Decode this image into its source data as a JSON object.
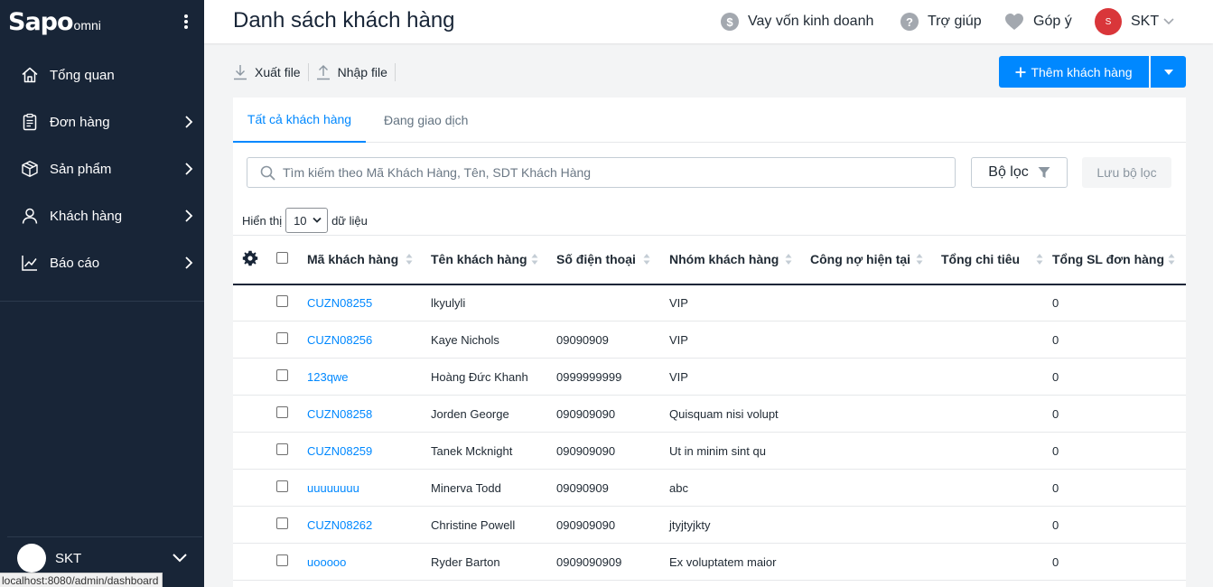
{
  "sidebar": {
    "logo_main": "Sapo",
    "logo_sub": "omni",
    "items": [
      {
        "label": "Tổng quan",
        "icon": "home-icon"
      },
      {
        "label": "Đơn hàng",
        "icon": "clipboard-icon"
      },
      {
        "label": "Sản phẩm",
        "icon": "box-icon"
      },
      {
        "label": "Khách hàng",
        "icon": "person-icon"
      },
      {
        "label": "Báo cáo",
        "icon": "chart-icon"
      }
    ],
    "user_name": "SKT"
  },
  "status_bar": {
    "url": "localhost:8080/admin/dashboard"
  },
  "header": {
    "title": "Danh sách khách hàng",
    "loan": "Vay vốn kinh doanh",
    "help": "Trợ giúp",
    "feedback": "Góp ý",
    "avatar_initial": "S",
    "user": "SKT"
  },
  "toolbar": {
    "export_label": "Xuất file",
    "import_label": "Nhập file",
    "add_label": "Thêm khách hàng"
  },
  "tabs": {
    "all": "Tất cả khách hàng",
    "trading": "Đang giao dịch"
  },
  "search": {
    "placeholder": "Tìm kiếm theo Mã Khách Hàng, Tên, SDT Khách Hàng"
  },
  "filter": {
    "label": "Bộ lọc",
    "save_label": "Lưu bộ lọc"
  },
  "pagination": {
    "show_prefix": "Hiển thị",
    "page_size": "10",
    "show_suffix": "dữ liệu"
  },
  "table": {
    "headers": {
      "code": "Mã khách hàng",
      "name": "Tên khách hàng",
      "phone": "Số điện thoại",
      "group": "Nhóm khách hàng",
      "debt": "Công nợ hiện tại",
      "spend": "Tổng chi tiêu",
      "orders": "Tổng SL đơn hàng"
    },
    "rows": [
      {
        "code": "CUZN08255",
        "name": "lkyulyli",
        "phone": "",
        "group": "VIP",
        "debt": "",
        "spend": "",
        "orders": "0"
      },
      {
        "code": "CUZN08256",
        "name": "Kaye Nichols",
        "phone": "09090909",
        "group": "VIP",
        "debt": "",
        "spend": "",
        "orders": "0"
      },
      {
        "code": "123qwe",
        "name": "Hoàng Đức Khanh",
        "phone": "0999999999",
        "group": "VIP",
        "debt": "",
        "spend": "",
        "orders": "0"
      },
      {
        "code": "CUZN08258",
        "name": "Jorden George",
        "phone": "090909090",
        "group": "Quisquam nisi volupt",
        "debt": "",
        "spend": "",
        "orders": "0"
      },
      {
        "code": "CUZN08259",
        "name": "Tanek Mcknight",
        "phone": "090909090",
        "group": "Ut in minim sint qu",
        "debt": "",
        "spend": "",
        "orders": "0"
      },
      {
        "code": "uuuuuuuu",
        "name": "Minerva Todd",
        "phone": "09090909",
        "group": "abc",
        "debt": "",
        "spend": "",
        "orders": "0"
      },
      {
        "code": "CUZN08262",
        "name": "Christine Powell",
        "phone": "090909090",
        "group": "jtyjtyjkty",
        "debt": "",
        "spend": "",
        "orders": "0"
      },
      {
        "code": "uooooo",
        "name": "Ryder Barton",
        "phone": "0909090909",
        "group": "Ex voluptatem maior",
        "debt": "",
        "spend": "",
        "orders": "0"
      }
    ]
  },
  "colors": {
    "accent": "#0088ff",
    "sidebar": "#182537",
    "avatar": "#d9363a"
  }
}
